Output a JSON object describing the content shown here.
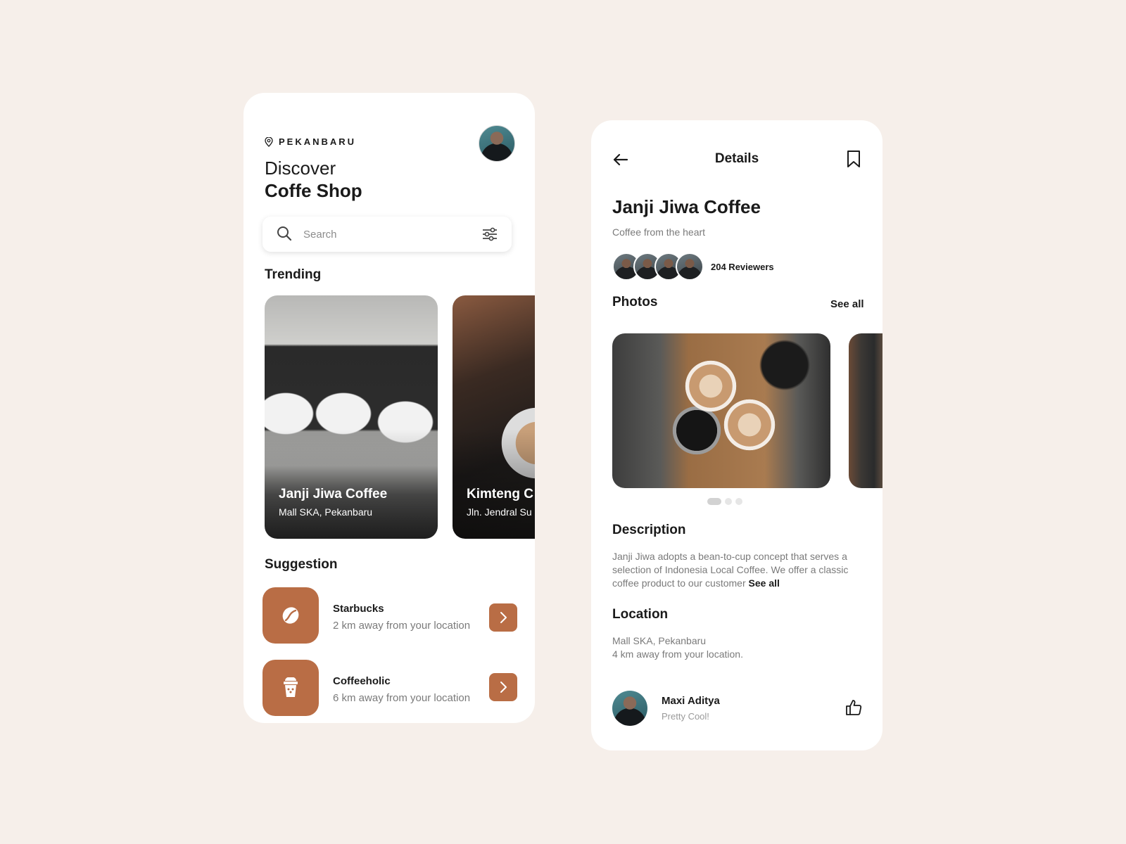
{
  "theme": {
    "accent": "#b96d45",
    "background": "#f6efea",
    "card": "#ffffff"
  },
  "discover": {
    "location": "PEKANBARU",
    "title_line1": "Discover",
    "title_line2": "Coffe Shop",
    "search": {
      "placeholder": "Search",
      "icon": "search-icon",
      "filter_icon": "sliders-icon"
    },
    "trending_label": "Trending",
    "trending": [
      {
        "name": "Janji Jiwa Coffee",
        "address": "Mall SKA, Pekanbaru"
      },
      {
        "name": "Kimteng C",
        "address": "Jln. Jendral Su"
      }
    ],
    "suggestion_label": "Suggestion",
    "suggestions": [
      {
        "name": "Starbucks",
        "distance": "2 km away from your location",
        "icon": "coffee-bean-icon"
      },
      {
        "name": "Coffeeholic",
        "distance": "6 km away from your location",
        "icon": "iced-coffee-cup-icon"
      }
    ]
  },
  "details": {
    "header_title": "Details",
    "shop_name": "Janji Jiwa Coffee",
    "tagline": "Coffee from the heart",
    "reviewers": "204 Reviewers",
    "photos_label": "Photos",
    "photos_see_all": "See all",
    "photo_page": {
      "current": 1,
      "total": 3
    },
    "description_label": "Description",
    "description_text": "Janji Jiwa adopts a bean-to-cup concept that serves a selection of Indonesia Local Coffee. We offer a classic coffee product to our customer ",
    "description_see_all": "See all",
    "location_label": "Location",
    "location_address": "Mall SKA, Pekanbaru",
    "location_distance": "4 km away from your location.",
    "comment": {
      "name": "Maxi Aditya",
      "text": "Pretty Cool!"
    }
  }
}
